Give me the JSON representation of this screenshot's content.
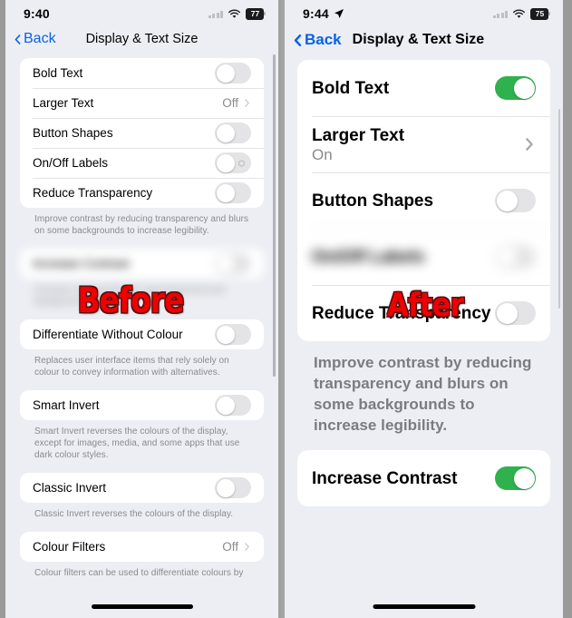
{
  "before": {
    "status": {
      "time": "9:40",
      "battery": "77",
      "wifi_icon": "wifi-icon",
      "cell_icon": "cellular-signal-icon"
    },
    "nav": {
      "back_label": "Back",
      "title": "Display & Text Size",
      "back_icon": "chevron-left-icon"
    },
    "card1_rows": [
      {
        "label": "Bold Text",
        "control": "toggle",
        "on": false
      },
      {
        "label": "Larger Text",
        "control": "disclosure",
        "value": "Off"
      },
      {
        "label": "Button Shapes",
        "control": "toggle",
        "on": false
      },
      {
        "label": "On/Off Labels",
        "control": "toggle-labels",
        "on": false
      },
      {
        "label": "Reduce Transparency",
        "control": "toggle",
        "on": false
      }
    ],
    "footnote1": "Improve contrast by reducing transparency and blurs on some backgrounds to increase legibility.",
    "blurred_row": {
      "label": "Increase Contrast",
      "control": "toggle",
      "on": false
    },
    "blurred_footnote": "Increase contrast between app foreground and background colours.",
    "card2_rows": [
      {
        "label": "Differentiate Without Colour",
        "control": "toggle",
        "on": false
      }
    ],
    "footnote2": "Replaces user interface items that rely solely on colour to convey information with alternatives.",
    "card3_rows": [
      {
        "label": "Smart Invert",
        "control": "toggle",
        "on": false
      }
    ],
    "footnote3": "Smart Invert reverses the colours of the display, except for images, media, and some apps that use dark colour styles.",
    "card4_rows": [
      {
        "label": "Classic Invert",
        "control": "toggle",
        "on": false
      }
    ],
    "footnote4": "Classic Invert reverses the colours of the display.",
    "card5_rows": [
      {
        "label": "Colour Filters",
        "control": "disclosure",
        "value": "Off"
      }
    ],
    "footnote5": "Colour filters can be used to differentiate colours by"
  },
  "after": {
    "status": {
      "time": "9:44",
      "battery": "75",
      "wifi_icon": "wifi-icon",
      "cell_icon": "cellular-signal-icon",
      "location_icon": "location-arrow-icon"
    },
    "nav": {
      "back_label": "Back",
      "title": "Display & Text Size",
      "back_icon": "chevron-left-icon"
    },
    "card1_rows": [
      {
        "label": "Bold Text",
        "control": "toggle",
        "on": true
      },
      {
        "label": "Larger Text",
        "sub": "On",
        "control": "disclosure"
      },
      {
        "label": "Button Shapes",
        "control": "toggle",
        "on": false
      }
    ],
    "blurred_row": {
      "label": "On/Off Labels",
      "control": "toggle",
      "on": false
    },
    "card1_rows_after_blur": [
      {
        "label": "Reduce Transparency",
        "control": "toggle",
        "on": false
      }
    ],
    "footnote1": "Improve contrast by reducing transparency and blurs on some backgrounds to increase legibility.",
    "card2_rows": [
      {
        "label": "Increase Contrast",
        "control": "toggle",
        "on": true
      }
    ]
  },
  "overlays": {
    "before_word": "Before",
    "after_word": "After",
    "color": "#f00000"
  }
}
